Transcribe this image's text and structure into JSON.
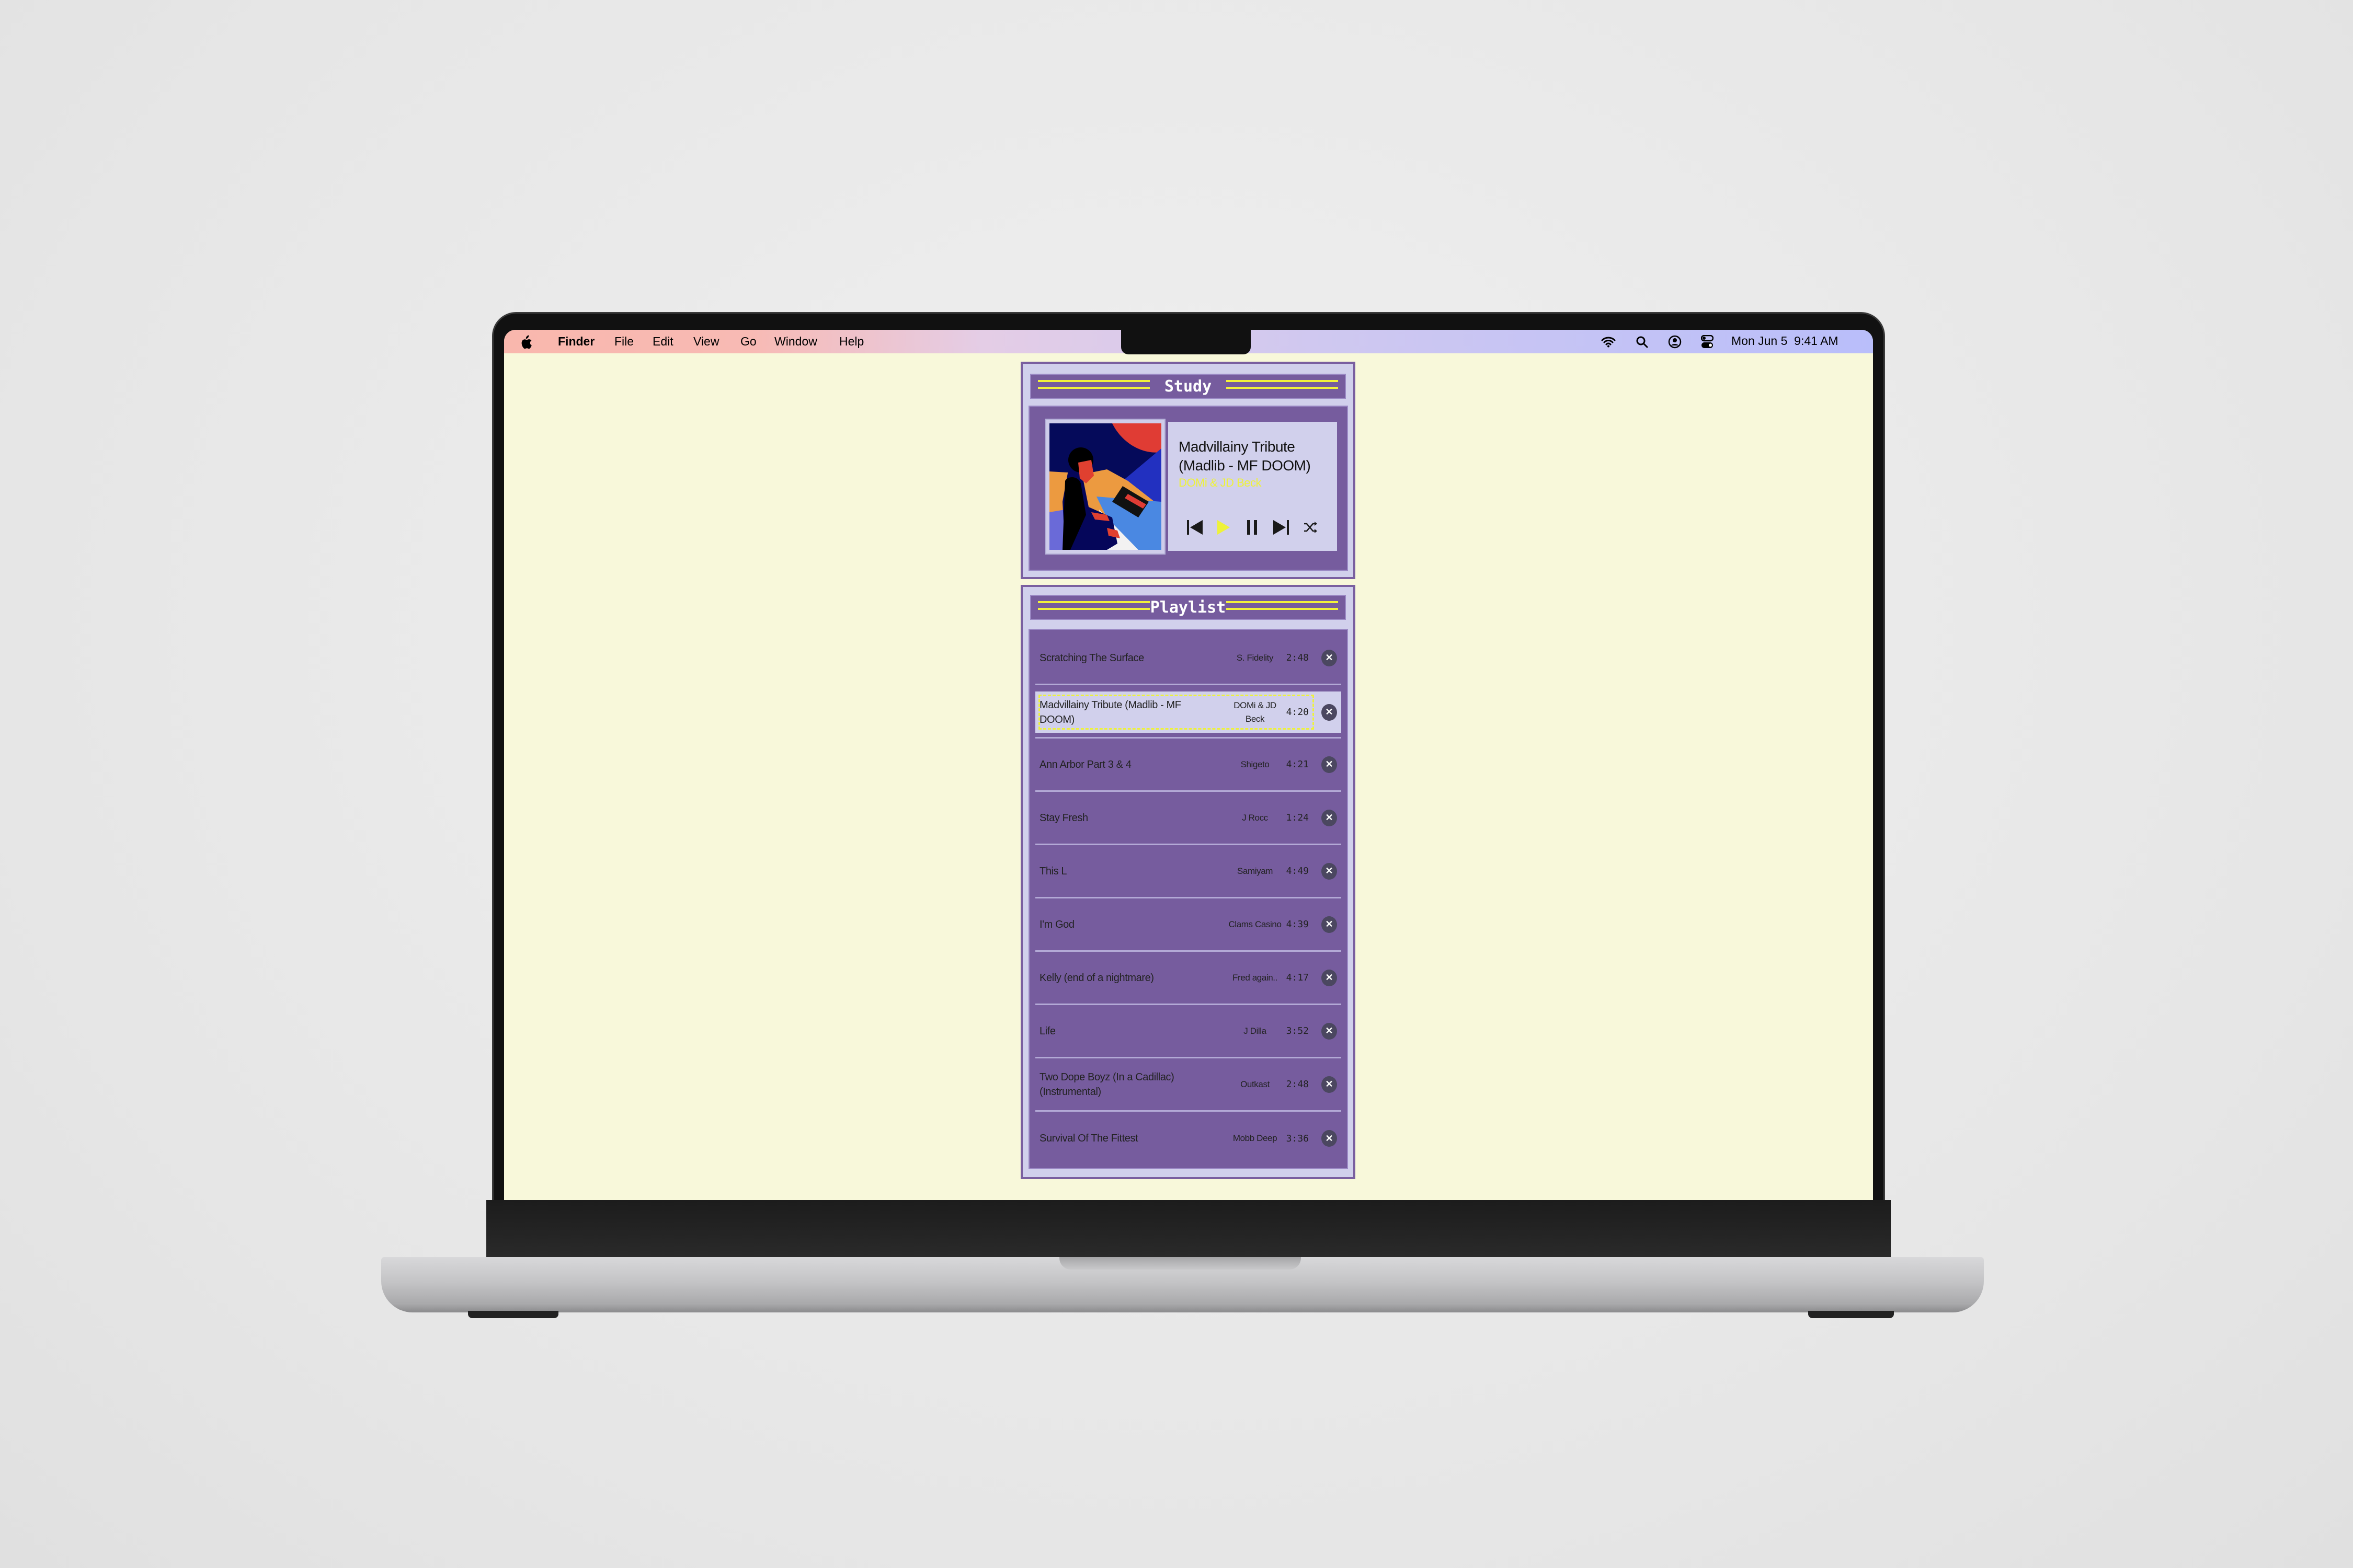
{
  "menubar": {
    "app_name": "Finder",
    "items": [
      "File",
      "Edit",
      "View",
      "Go",
      "Window",
      "Help"
    ],
    "status_icons": [
      "wifi-icon",
      "search-icon",
      "user-icon",
      "control-center-icon"
    ],
    "datetime": "Mon Jun 5  9:41 AM"
  },
  "player": {
    "title": "Study",
    "track_title": "Madvillainy Tribute (Madlib - MF DOOM)",
    "track_artist": "DOMi & JD Beck",
    "controls": [
      "previous-icon",
      "play-icon",
      "pause-icon",
      "next-icon",
      "shuffle-icon"
    ]
  },
  "playlist": {
    "title": "Playlist",
    "tracks": [
      {
        "title": "Scratching The Surface",
        "artist": "S. Fidelity",
        "time": "2:48",
        "selected": false
      },
      {
        "title": "Madvillainy Tribute (Madlib - MF DOOM)",
        "artist": "DOMi & JD Beck",
        "time": "4:20",
        "selected": true
      },
      {
        "title": "Ann Arbor Part 3 & 4",
        "artist": "Shigeto",
        "time": "4:21",
        "selected": false
      },
      {
        "title": "Stay Fresh",
        "artist": "J Rocc",
        "time": "1:24",
        "selected": false
      },
      {
        "title": "This L",
        "artist": "Samiyam",
        "time": "4:49",
        "selected": false
      },
      {
        "title": "I'm God",
        "artist": "Clams Casino",
        "time": "4:39",
        "selected": false
      },
      {
        "title": "Kelly (end of a nightmare)",
        "artist": "Fred again..",
        "time": "4:17",
        "selected": false
      },
      {
        "title": "Life",
        "artist": "J Dilla",
        "time": "3:52",
        "selected": false
      },
      {
        "title": "Two Dope Boyz (In a Cadillac) (Instrumental)",
        "artist": "Outkast",
        "time": "2:48",
        "selected": false
      },
      {
        "title": "Survival Of The Fittest",
        "artist": "Mobb Deep",
        "time": "3:36",
        "selected": false
      }
    ],
    "remove_icon": "x-icon"
  },
  "colors": {
    "screen_bg": "#f8f8da",
    "panel_bg": "#d1d0ec",
    "panel_purple": "#765c9e",
    "accent_yellow": "#eef23a",
    "remove_button": "#4b4760"
  }
}
